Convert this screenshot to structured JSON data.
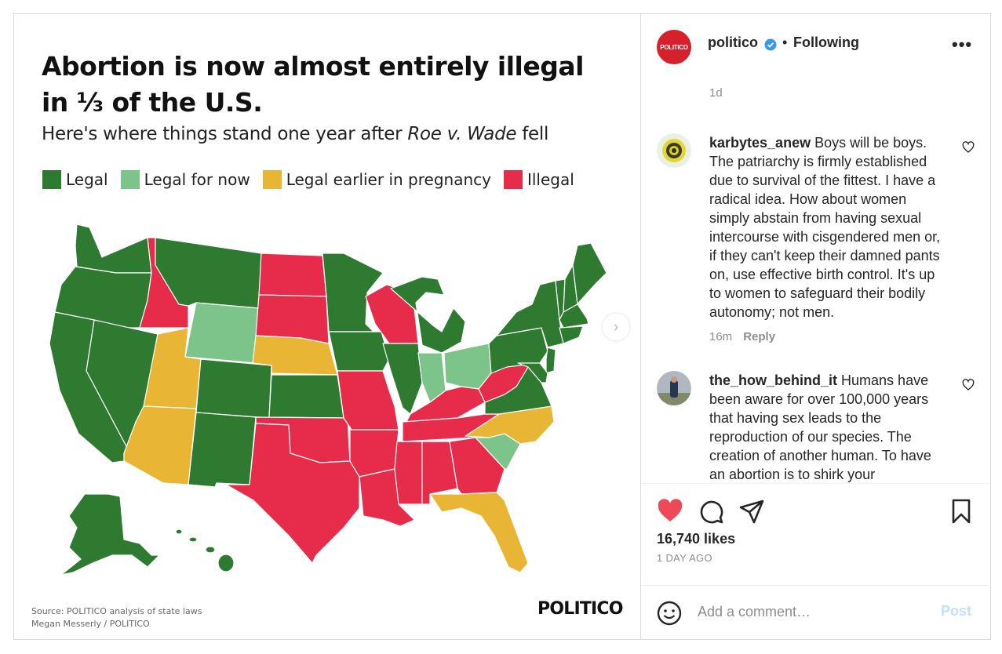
{
  "graphic": {
    "title": "Abortion is now almost entirely illegal in ⅓ of the U.S.",
    "subtitle_prefix": "Here's where things stand one year after ",
    "subtitle_italic": "Roe v. Wade",
    "subtitle_suffix": " fell",
    "legend": [
      {
        "label": "Legal",
        "color": "#2d7a30"
      },
      {
        "label": "Legal for now",
        "color": "#7dc48b"
      },
      {
        "label": "Legal earlier in pregnancy",
        "color": "#e8b634"
      },
      {
        "label": "Illegal",
        "color": "#e62b4b"
      }
    ],
    "source_line1": "Source: POLITICO analysis of state laws",
    "source_line2": "Megan Messerly / POLITICO",
    "logo": "POLITICO",
    "next_icon": "chevron-right-icon"
  },
  "header": {
    "avatar_text": "POLITICO",
    "username": "politico",
    "separator": "•",
    "follow_status": "Following",
    "more": "•••"
  },
  "comments": {
    "post_age": "1d",
    "items": [
      {
        "user": "karbytes_anew",
        "text": "Boys will be boys. The patriarchy is firmly established due to survival of the fittest. I have a radical idea. How about women simply abstain from having sexual intercourse with cisgendered men or, if they can't keep their damned pants on, use effective birth control. It's up to women to safeguard their bodily autonomy; not men.",
        "time": "16m",
        "reply": "Reply"
      },
      {
        "user": "the_how_behind_it",
        "text": "Humans have been aware for over 100,000 years that having sex leads to the reproduction of our species. The creation of another human. To have an abortion is to shirk your responsibility after creating another",
        "time": "",
        "reply": ""
      }
    ]
  },
  "actions": {
    "likes": "16,740 likes",
    "post_age": "1 DAY AGO"
  },
  "add_comment": {
    "placeholder": "Add a comment…",
    "post_label": "Post"
  }
}
